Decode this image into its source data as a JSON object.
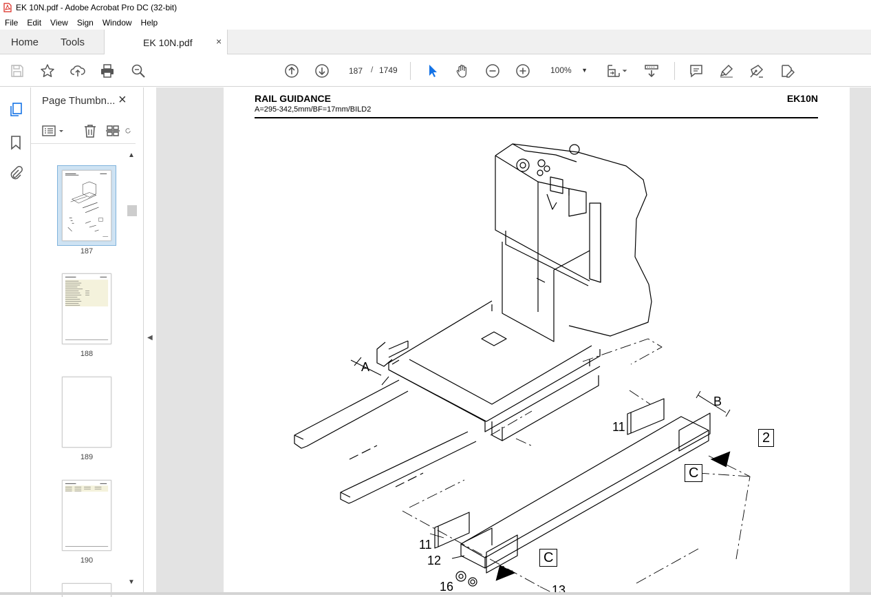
{
  "window": {
    "title": "EK 10N.pdf - Adobe Acrobat Pro DC (32-bit)"
  },
  "menu": {
    "items": [
      "File",
      "Edit",
      "View",
      "Sign",
      "Window",
      "Help"
    ]
  },
  "tabs": {
    "home": "Home",
    "tools": "Tools",
    "document": "EK 10N.pdf",
    "close": "×"
  },
  "toolbar": {
    "icons": [
      "save-icon",
      "star-icon",
      "upload-icon",
      "print-icon",
      "zoom-search-icon",
      "arrow-up-icon",
      "arrow-down-icon",
      "select-arrow-icon",
      "hand-icon",
      "zoom-out-icon",
      "zoom-in-icon",
      "fit-page-icon",
      "scroll-mode-icon",
      "comment-icon",
      "highlight-icon",
      "sign-icon",
      "edit-icon"
    ],
    "current_page": "187",
    "page_separator": "/",
    "total_pages": "1749",
    "zoom": "100%"
  },
  "panel": {
    "title": "Page Thumbn...",
    "close": "×",
    "thumbnails": [
      {
        "page": "187",
        "selected": true
      },
      {
        "page": "188",
        "selected": false
      },
      {
        "page": "189",
        "selected": false
      },
      {
        "page": "190",
        "selected": false
      }
    ]
  },
  "document": {
    "title": "RAIL GUIDANCE",
    "subtitle": "A=295-342,5mm/BF=17mm/BILD2",
    "model": "EK10N",
    "callouts": {
      "a": "A",
      "b": "B",
      "c1": "C",
      "c2": "C",
      "box2": "2",
      "p11a": "11",
      "p11b": "11",
      "p12": "12",
      "p16": "16",
      "p13": "13"
    }
  },
  "colors": {
    "selection": "#cfe3f3",
    "selection_border": "#7fb3dc",
    "acrobat_red": "#d9261c"
  }
}
